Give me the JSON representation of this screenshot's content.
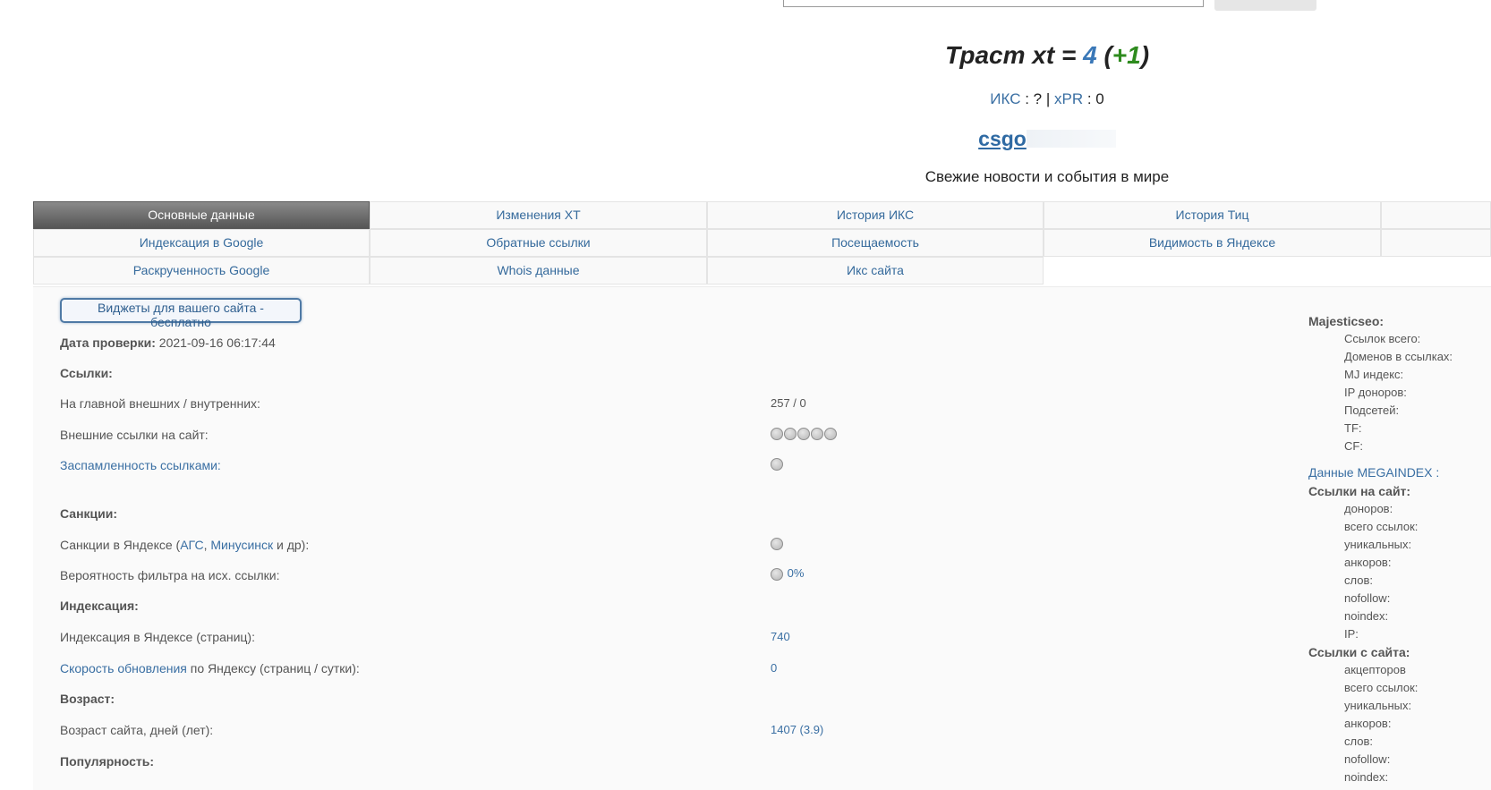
{
  "search": {
    "value": "",
    "button_label": ""
  },
  "header": {
    "trust_prefix": "Траст xt = ",
    "trust_value": "4",
    "trust_open": " (",
    "trust_delta": "+1",
    "trust_close": ")",
    "iks_label": "ИКС",
    "iks_value": " : ? | ",
    "xpr_label": "xPR",
    "xpr_value": " : 0",
    "domain": "csgo",
    "subtitle": "Свежие новости и события в мире"
  },
  "tabs": [
    {
      "label": "Основные данные",
      "active": true
    },
    {
      "label": "Изменения XT"
    },
    {
      "label": "История ИКС"
    },
    {
      "label": "История Тиц"
    },
    {
      "label": ""
    },
    {
      "label": "Индексация в Google"
    },
    {
      "label": "Обратные ссылки"
    },
    {
      "label": "Посещаемость"
    },
    {
      "label": "Видимость в Яндексе"
    },
    {
      "label": ""
    },
    {
      "label": "Раскрученность Google"
    },
    {
      "label": "Whois данные"
    },
    {
      "label": "Икс сайта"
    }
  ],
  "main": {
    "widget_button": "Виджеты для вашего сайта - бесплатно",
    "check_date_label": "Дата проверки:",
    "check_date_value": " 2021-09-16 06:17:44",
    "sections": {
      "links": "Ссылки:",
      "sanctions": "Санкции:",
      "indexing": "Индексация:",
      "age": "Возраст:",
      "popularity": "Популярность:"
    },
    "rows": {
      "home_links_label": "На главной внешних / внутренних:",
      "home_links_value": "257 / 0",
      "external_links_label": "Внешние ссылки на сайт:",
      "spam_label": "Заспамленность ссылками:",
      "yandex_sanctions_prefix": "Санкции в Яндексе (",
      "yandex_sanctions_ags": "АГС",
      "yandex_sanctions_sep": ", ",
      "yandex_sanctions_minusinsk": "Минусинск",
      "yandex_sanctions_suffix": " и др):",
      "filter_prob_label": "Вероятность фильтра на исх. ссылки:",
      "filter_prob_value": "0%",
      "yandex_index_label": "Индексация в Яндексе (страниц):",
      "yandex_index_value": "740",
      "update_speed_link": "Скорость обновления",
      "update_speed_rest": " по Яндексу (страниц / сутки):",
      "update_speed_value": "0",
      "site_age_label": "Возраст сайта, дней (лет):",
      "site_age_value": "1407 (3.9)"
    }
  },
  "sidebar": {
    "majestic_title": "Majesticseo:",
    "majestic_items": [
      "Ссылок всего:",
      "Доменов в ссылках:",
      "MJ индекс:",
      "IP доноров:",
      "Подсетей:",
      "TF:",
      "CF:"
    ],
    "megaindex_link": "Данные MEGAINDEX :",
    "links_to_site_title": "Ссылки на сайт:",
    "links_to_site_items": [
      "доноров:",
      "всего ссылок:",
      "уникальных:",
      "анкоров:",
      "слов:",
      "nofollow:",
      "noindex:",
      "IP:"
    ],
    "links_from_site_title": "Ссылки с сайта:",
    "links_from_site_items": [
      "акцепторов",
      "всего ссылок:",
      "уникальных:",
      "анкоров:",
      "слов:",
      "nofollow:",
      "noindex:"
    ]
  }
}
